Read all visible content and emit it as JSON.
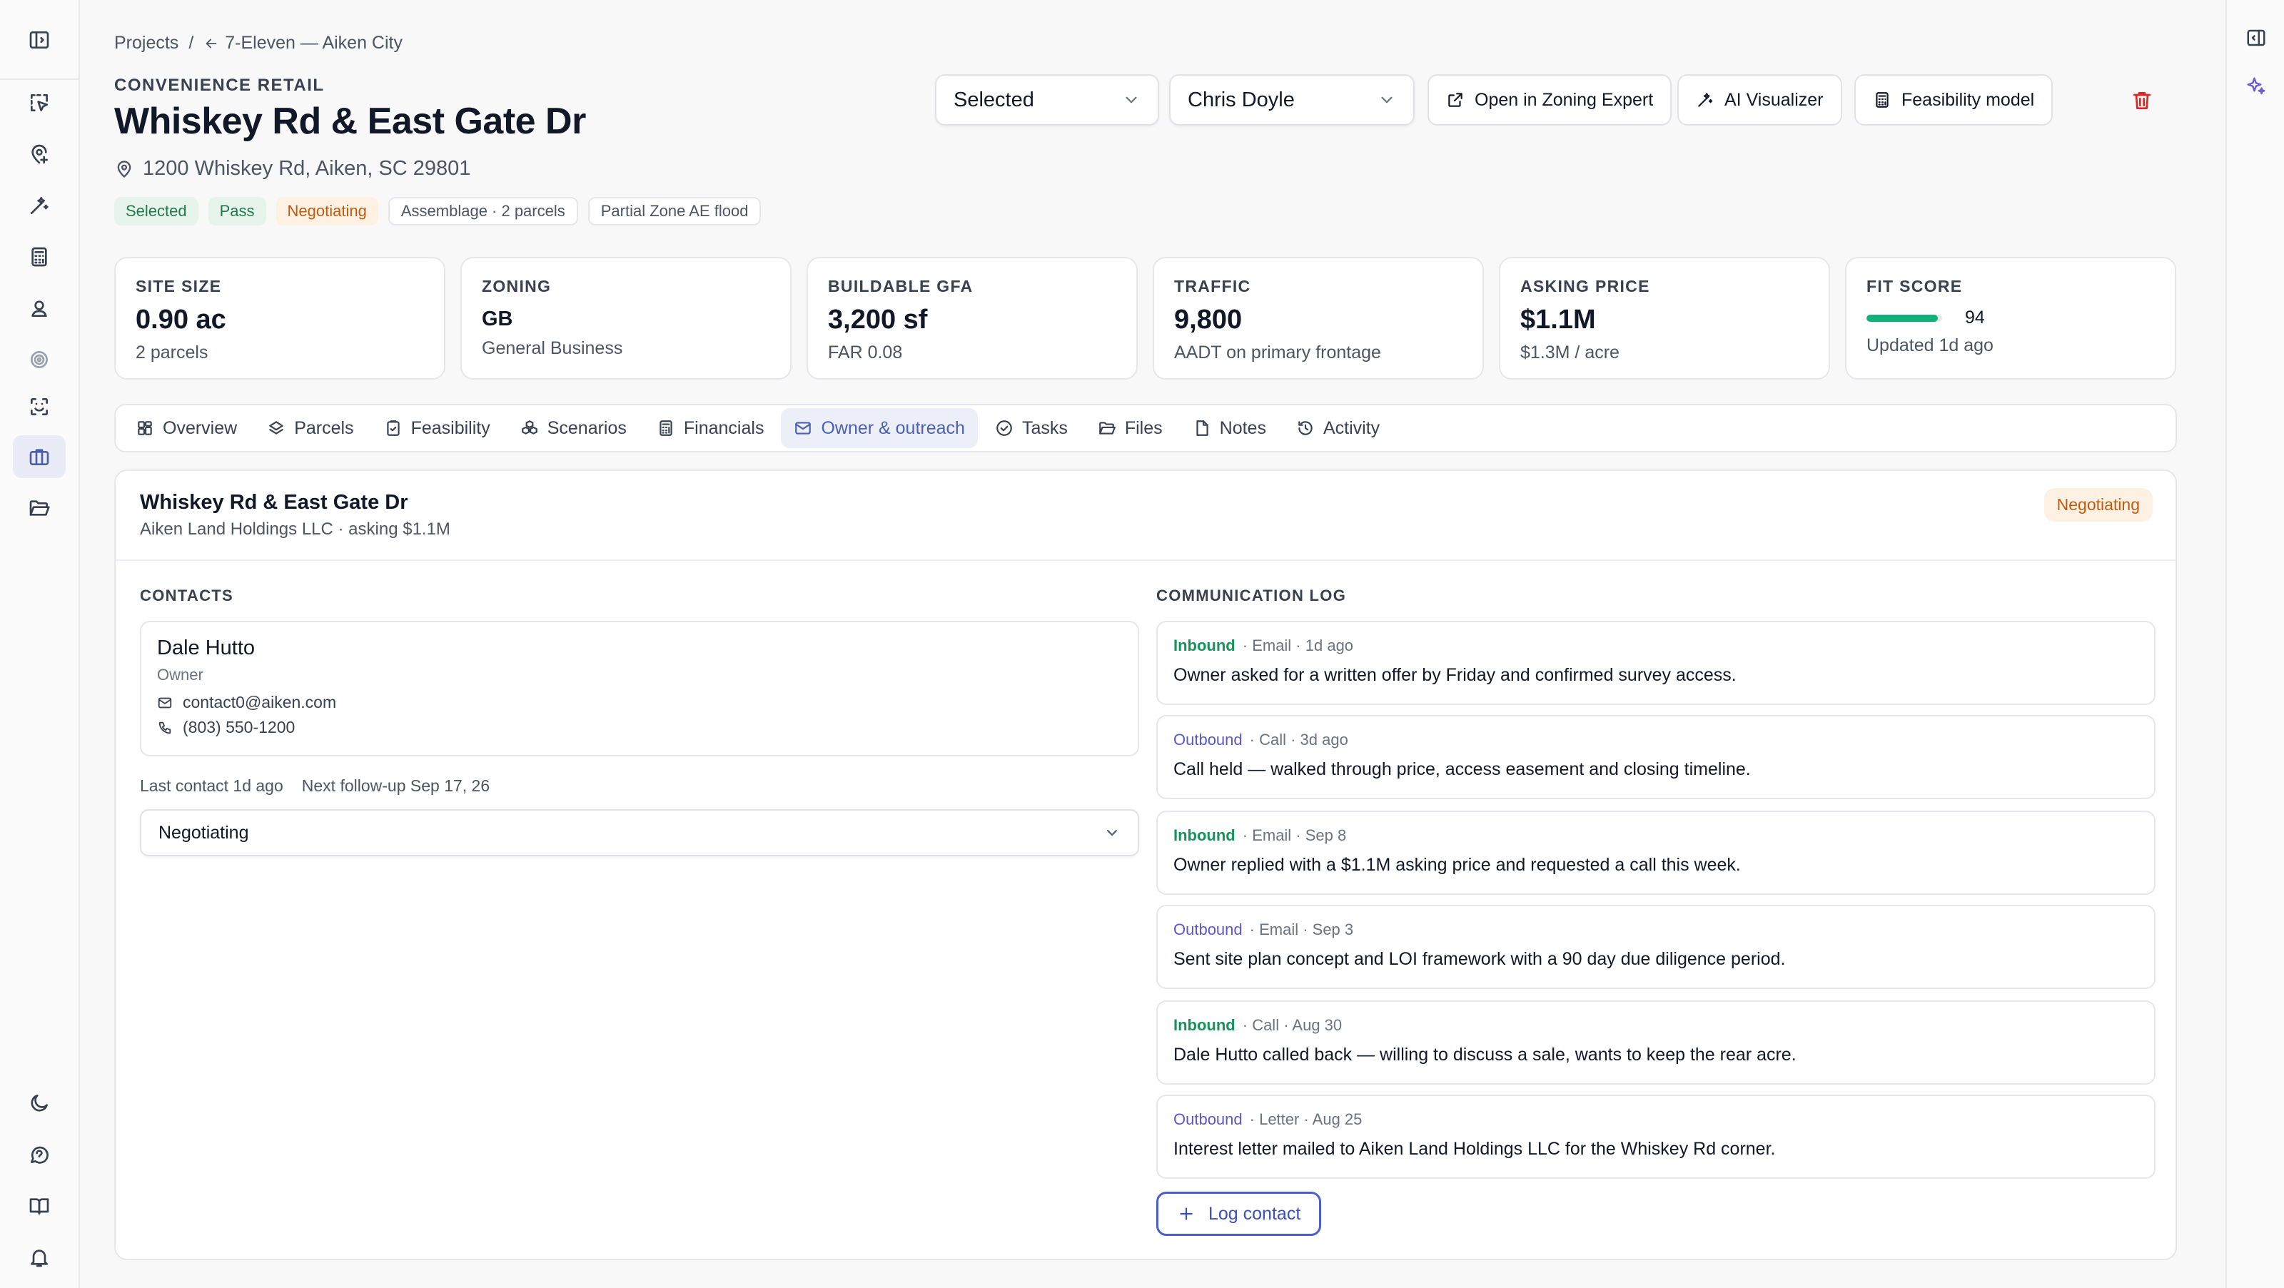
{
  "breadcrumb": {
    "root": "Projects",
    "separator": "/",
    "current": "7-Eleven — Aiken City"
  },
  "site": {
    "category": "CONVENIENCE RETAIL",
    "title": "Whiskey Rd & East Gate Dr",
    "address": "1200 Whiskey Rd, Aiken, SC 29801",
    "tags": [
      "Selected",
      "Pass",
      "Negotiating",
      "Assemblage · 2 parcels",
      "Partial Zone AE flood"
    ]
  },
  "controls": {
    "status_select": "Selected",
    "owner_select": "Chris Doyle",
    "zoning_button": "Open in Zoning Expert",
    "visualizer_button": "AI Visualizer",
    "feasibility_button": "Feasibility model"
  },
  "stats": [
    {
      "label": "SITE SIZE",
      "value": "0.90 ac",
      "sub": "2 parcels"
    },
    {
      "label": "ZONING",
      "value": "GB",
      "sub": "General Business"
    },
    {
      "label": "BUILDABLE GFA",
      "value": "3,200 sf",
      "sub": "FAR 0.08"
    },
    {
      "label": "TRAFFIC",
      "value": "9,800",
      "sub": "AADT on primary frontage"
    },
    {
      "label": "ASKING PRICE",
      "value": "$1.1M",
      "sub": "$1.3M / acre"
    },
    {
      "label": "FIT SCORE",
      "value": "94",
      "score": 94,
      "sub": "Updated 1d ago"
    }
  ],
  "tabs": [
    "Overview",
    "Parcels",
    "Feasibility",
    "Scenarios",
    "Financials",
    "Owner & outreach",
    "Tasks",
    "Files",
    "Notes",
    "Activity"
  ],
  "active_tab": "Owner & outreach",
  "outreach": {
    "title": "Whiskey Rd & East Gate Dr",
    "subtitle": "Aiken Land Holdings LLC · asking $1.1M",
    "status_badge": "Negotiating",
    "contacts_heading": "CONTACTS",
    "log_heading": "COMMUNICATION LOG",
    "contact": {
      "name": "Dale Hutto",
      "role": "Owner",
      "email": "contact0@aiken.com",
      "phone": "(803) 550-1200"
    },
    "last_contact": "Last contact 1d ago",
    "next_followup": "Next follow-up Sep 17, 26",
    "stage_select": "Negotiating",
    "log": [
      {
        "direction": "Inbound",
        "meta": "· Email · 1d ago",
        "text": "Owner asked for a written offer by Friday and confirmed survey access."
      },
      {
        "direction": "Outbound",
        "meta": "· Call · 3d ago",
        "text": "Call held — walked through price, access easement and closing timeline."
      },
      {
        "direction": "Inbound",
        "meta": "· Email · Sep 8",
        "text": "Owner replied with a $1.1M asking price and requested a call this week."
      },
      {
        "direction": "Outbound",
        "meta": "· Email · Sep 3",
        "text": "Sent site plan concept and LOI framework with a 90 day due diligence period."
      },
      {
        "direction": "Inbound",
        "meta": "· Call · Aug 30",
        "text": "Dale Hutto called back — willing to discuss a sale, wants to keep the rear acre."
      },
      {
        "direction": "Outbound",
        "meta": "· Letter · Aug 25",
        "text": "Interest letter mailed to Aiken Land Holdings LLC for the Whiskey Rd corner."
      }
    ],
    "log_button": "Log contact"
  },
  "colors": {
    "accent": "#4c61b3",
    "inbound": "#15935a",
    "outbound": "#5b57d1",
    "negotiating": "#c25a0e",
    "danger": "#dc2626"
  },
  "icons": {
    "left_rail": [
      "sidebar-toggle-icon",
      "select-area-icon",
      "map-pin-icon",
      "magic-wand-icon",
      "calculator-icon",
      "user-pin-icon",
      "target-icon",
      "scan-icon",
      "briefcase-icon",
      "folder-open-icon",
      "moon-icon",
      "chat-icon",
      "book-icon",
      "bell-icon"
    ],
    "right_rail": [
      "panel-toggle-icon",
      "sparkles-icon"
    ]
  }
}
